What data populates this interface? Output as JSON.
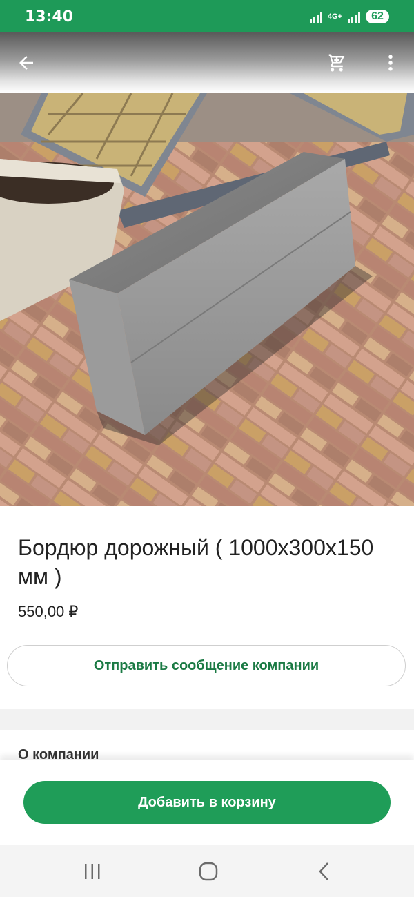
{
  "status_bar": {
    "time": "13:40",
    "network": "4G+",
    "battery": "62"
  },
  "app_bar": {
    "back_icon": "arrow-left-icon",
    "cart_icon": "cart-icon",
    "more_icon": "more-vertical-icon"
  },
  "product": {
    "image_alt": "Бордюр дорожный на тротуарной плитке",
    "title": "Бордюр дорожный ( 1000x300x150 мм )",
    "price": "550,00 ₽"
  },
  "actions": {
    "message_company": "Отправить сообщение компании",
    "add_to_cart": "Добавить в корзину"
  },
  "sections": {
    "about_company": "О компании"
  },
  "colors": {
    "primary": "#1f9d58",
    "primary_text": "#1b7a44",
    "status_bar": "#1e9a58"
  },
  "nav_bar": {
    "recent_icon": "recent-apps-icon",
    "home_icon": "home-icon",
    "back_icon": "back-nav-icon"
  }
}
